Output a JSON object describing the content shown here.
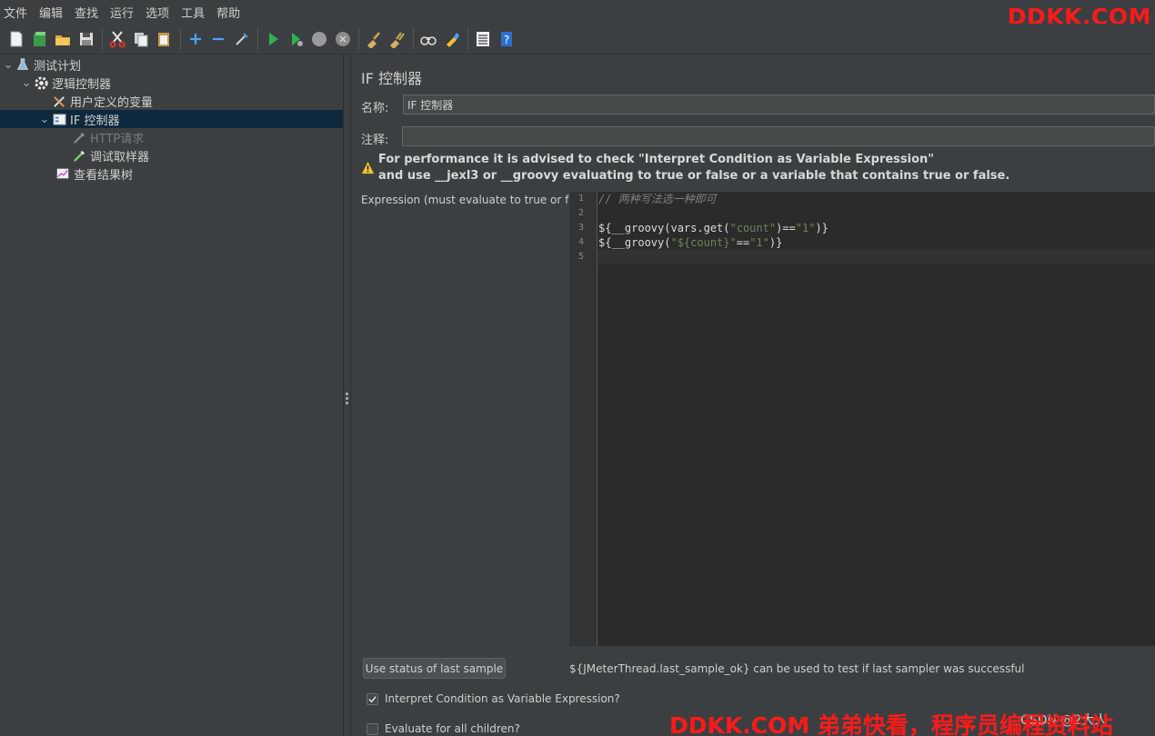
{
  "menu": [
    "文件",
    "编辑",
    "查找",
    "运行",
    "选项",
    "工具",
    "帮助"
  ],
  "toolbar": {
    "icons": [
      "new-icon",
      "templates-icon",
      "open-icon",
      "save-icon",
      "cut-icon",
      "copy-icon",
      "paste-icon",
      "expand-icon",
      "collapse-icon",
      "toggle-icon",
      "start-icon",
      "start-no-pause-icon",
      "stop-icon",
      "shutdown-icon",
      "clear-icon",
      "clear-all-icon",
      "search-icon",
      "reset-search-icon",
      "function-helper-icon",
      "help-icon"
    ]
  },
  "watermark": {
    "top": "DDKK.COM",
    "bottom": "DDKK.COM 弟弟快看，程序员编程资料站"
  },
  "tree": {
    "items": [
      {
        "label": "测试计划",
        "level": 0,
        "expanded": true
      },
      {
        "label": "逻辑控制器",
        "level": 1,
        "expanded": true
      },
      {
        "label": "用户定义的变量",
        "level": 2
      },
      {
        "label": "IF 控制器",
        "level": 2,
        "expanded": true,
        "selected": true
      },
      {
        "label": "HTTP请求",
        "level": 3,
        "disabled": true
      },
      {
        "label": "调试取样器",
        "level": 3
      },
      {
        "label": "查看结果树",
        "level": 2
      }
    ]
  },
  "panel": {
    "title": "IF 控制器",
    "name_label": "名称:",
    "name_value": "IF 控制器",
    "comment_label": "注释:",
    "comment_value": "",
    "warning_line1": "For performance it is advised to check \"Interpret Condition as Variable Expression\"",
    "warning_line2": "and use __jexl3 or __groovy evaluating to true or false or a variable that contains true or false.",
    "expression_label": "Expression (must evaluate to true or false)",
    "line_numbers": [
      "1",
      "2",
      "3",
      "4",
      "5"
    ],
    "use_status_button": "Use status of last sample",
    "hint": "${JMeterThread.last_sample_ok} can be used to test if last sampler was successful",
    "interpret_label": "Interpret Condition as Variable Expression?",
    "interpret_checked": true,
    "evaluate_label": "Evaluate for all children?",
    "evaluate_checked": false,
    "faint_mark": "CSDN @2大人"
  },
  "code": {
    "line1": "// 两种写法选一种即可",
    "line3_a": "${__groovy(vars.get(",
    "line3_b": "\"count\"",
    "line3_c": ")==",
    "line3_d": "\"1\"",
    "line3_e": ")}",
    "line4_a": "${__groovy(",
    "line4_b": "\"${count}\"",
    "line4_c": "==",
    "line4_d": "\"1\"",
    "line4_e": ")}"
  }
}
